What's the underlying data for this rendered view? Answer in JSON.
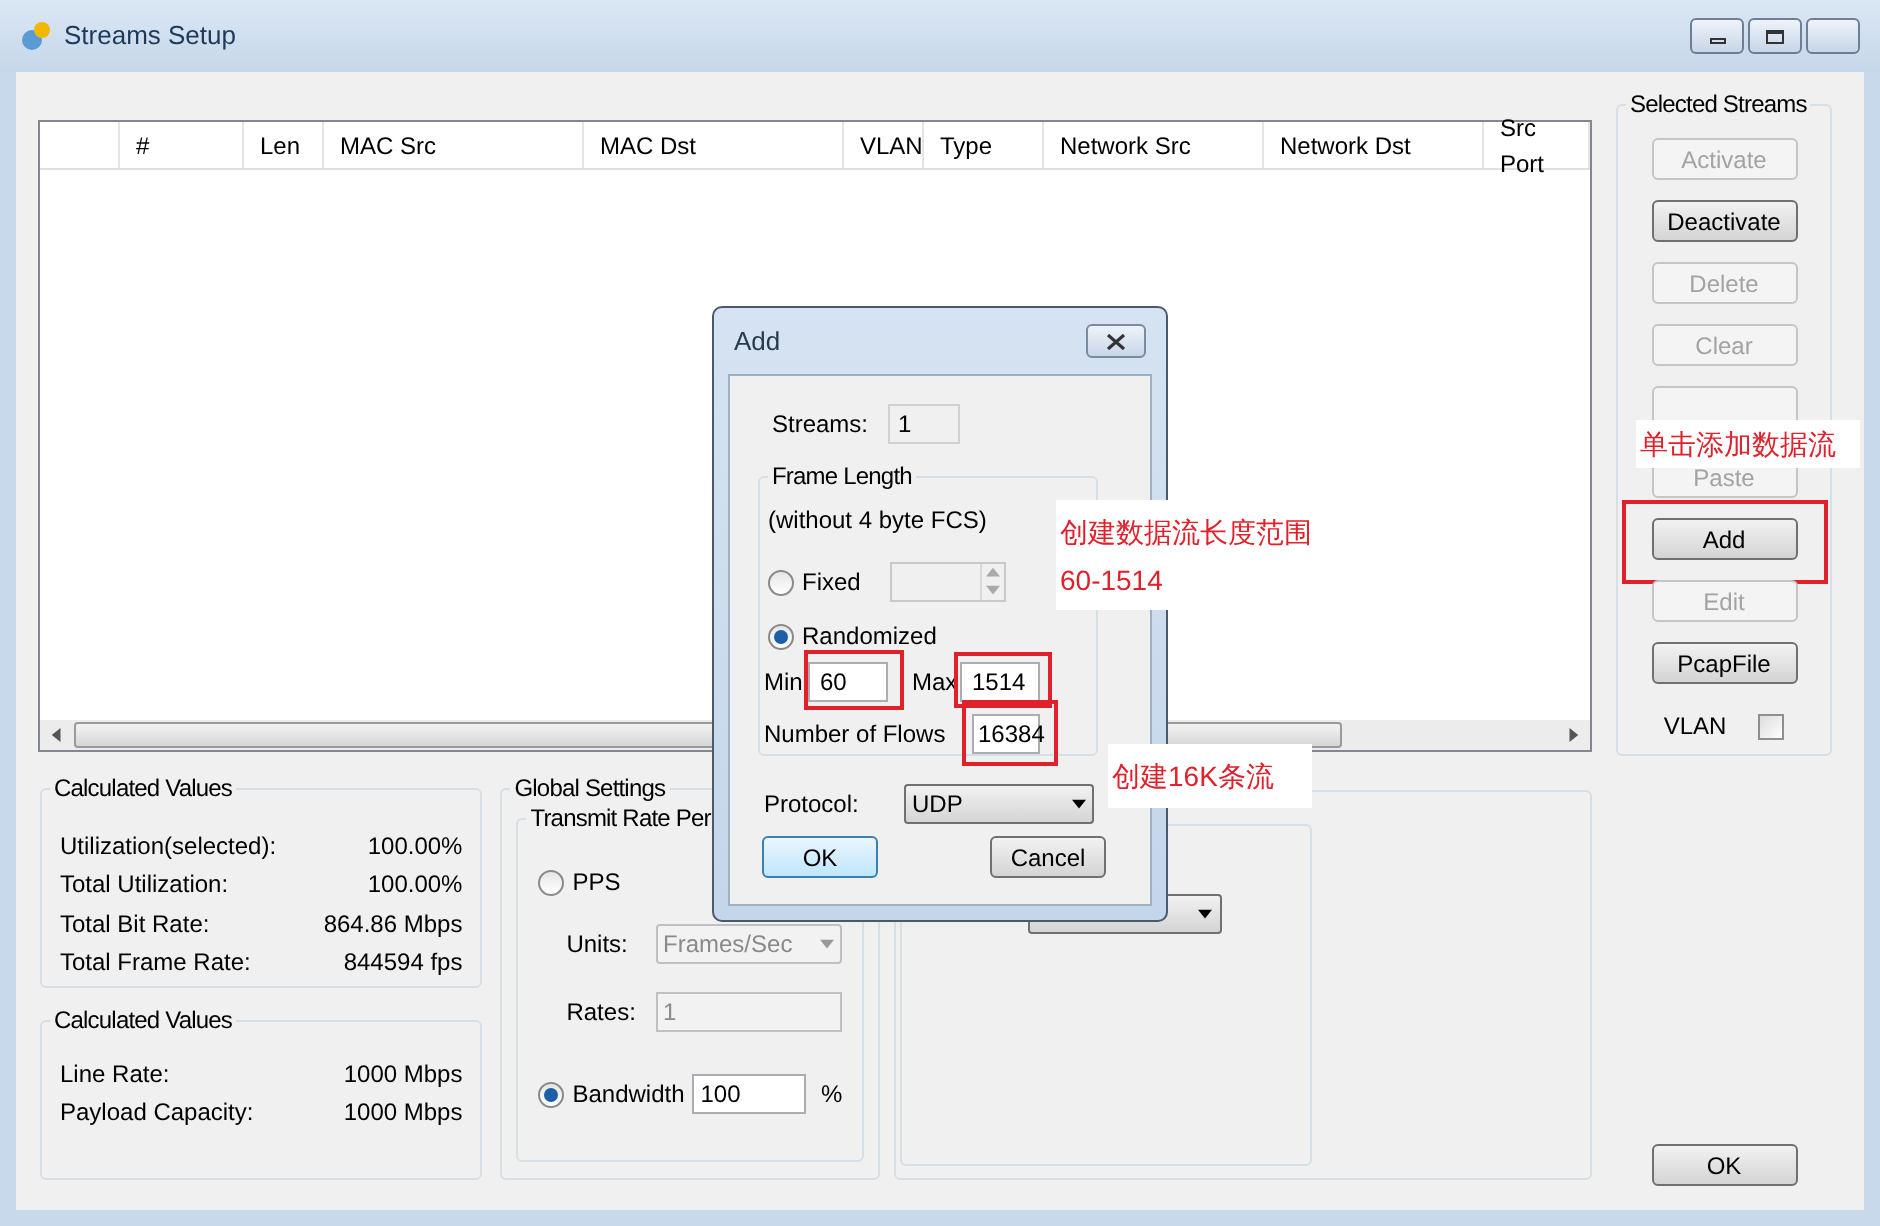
{
  "window": {
    "title": "Streams Setup"
  },
  "table": {
    "columns": [
      "",
      "#",
      "Len",
      "MAC Src",
      "MAC Dst",
      "VLAN",
      "Type",
      "Network Src",
      "Network Dst",
      "Src Port"
    ]
  },
  "selected_streams": {
    "title": "Selected Streams",
    "buttons": [
      {
        "label": "Activate",
        "disabled": true,
        "highlighted": false
      },
      {
        "label": "Deactivate",
        "disabled": false,
        "highlighted": false
      },
      {
        "label": "Delete",
        "disabled": true,
        "highlighted": false
      },
      {
        "label": "Clear",
        "disabled": true,
        "highlighted": false
      },
      {
        "disabled": true,
        "highlighted": false
      },
      {
        "label": "Paste",
        "disabled": true,
        "highlighted": false
      },
      {
        "label": "Add",
        "disabled": false,
        "highlighted": true
      },
      {
        "label": "Edit",
        "disabled": true,
        "highlighted": false
      },
      {
        "label": "PcapFile",
        "disabled": false,
        "highlighted": false
      }
    ],
    "vlan": {
      "label": "VLAN",
      "checked": false
    }
  },
  "calculated_values": [
    {
      "title": "Calculated Values",
      "rows": [
        {
          "label": "Utilization(selected):",
          "value": "100.00%"
        },
        {
          "label": "Total Utilization:",
          "value": "100.00%"
        },
        {
          "label": "Total Bit Rate:",
          "value": "864.86 Mbps"
        },
        {
          "label": "Total Frame Rate:",
          "value": "844594 fps"
        }
      ]
    },
    {
      "title": "Calculated Values",
      "rows": [
        {
          "label": "Line Rate:",
          "value": "1000 Mbps"
        },
        {
          "label": "Payload Capacity:",
          "value": "1000 Mbps"
        }
      ]
    }
  ],
  "global_settings": {
    "title": "Global Settings",
    "group_title": "Transmit Rate Per",
    "pps": {
      "label": "PPS",
      "selected": false
    },
    "units": {
      "label": "Units:",
      "value": "Frames/Sec",
      "disabled": true
    },
    "rates": {
      "label": "Rates:",
      "value": "1",
      "disabled": true
    },
    "bandwidth": {
      "label": "Bandwidth",
      "selected": true,
      "value": "100",
      "unit": "%"
    }
  },
  "ok_button": "OK",
  "dialog": {
    "title": "Add",
    "streams": {
      "label": "Streams:",
      "value": "1"
    },
    "frame_length": {
      "title": "Frame Length",
      "note": "(without 4 byte FCS)",
      "fixed": {
        "label": "Fixed",
        "selected": false
      },
      "randomized": {
        "label": "Randomized",
        "selected": true
      },
      "min": {
        "label": "Min",
        "value": "60",
        "highlighted": true
      },
      "max": {
        "label": "Max",
        "value": "1514",
        "highlighted": true
      },
      "flows": {
        "label": "Number of Flows",
        "value": "16384",
        "highlighted": true
      }
    },
    "protocol": {
      "label": "Protocol:",
      "value": "UDP"
    },
    "buttons": [
      {
        "label": "OK",
        "default": true
      },
      {
        "label": "Cancel",
        "default": false
      }
    ]
  },
  "annotations": [
    {
      "lines": [
        "单击添加数据流"
      ]
    },
    {
      "lines": [
        "创建数据流长度范围",
        "60-1514"
      ]
    },
    {
      "lines": [
        "创建16K条流"
      ]
    }
  ]
}
